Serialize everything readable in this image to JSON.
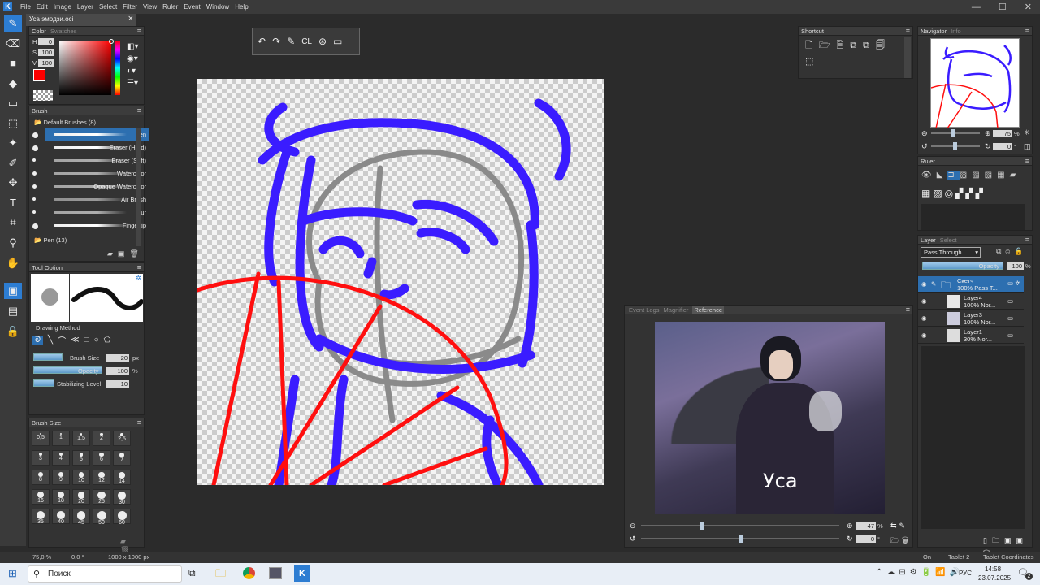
{
  "app": {
    "logo": "K",
    "menus": [
      "File",
      "Edit",
      "Image",
      "Layer",
      "Select",
      "Filter",
      "View",
      "Ruler",
      "Event",
      "Window",
      "Help"
    ],
    "doc_tab": "Уса эмодзи.oci",
    "win_min": "—",
    "win_max": "☐",
    "win_close": "✕"
  },
  "color_panel": {
    "tabs": [
      "Color",
      "Swatches"
    ],
    "h_label": "H",
    "s_label": "S",
    "v_label": "V",
    "h": "0",
    "s": "100",
    "v": "100",
    "primary": "#ff0000"
  },
  "brush_panel": {
    "title": "Brush",
    "group": "Default Brushes (8)",
    "items": [
      "Pen",
      "Eraser (Hard)",
      "Eraser (Soft)",
      "Watercolor",
      "Opaque Watercolor",
      "Air Brush",
      "Blur",
      "Fingertip"
    ],
    "group2": "Pen (13)"
  },
  "tool_option": {
    "title": "Tool Option",
    "drawing_method": "Drawing Method",
    "brush_size_label": "Brush Size",
    "brush_size": "20",
    "brush_size_unit": "px",
    "opacity_label": "Opacity",
    "opacity": "100",
    "opacity_unit": "%",
    "stab_label": "Stabilizing Level",
    "stab": "10"
  },
  "brush_size_panel": {
    "title": "Brush Size",
    "sizes": [
      "0,5",
      "1",
      "1,5",
      "2",
      "2,5",
      "3",
      "4",
      "5",
      "6",
      "7",
      "8",
      "9",
      "10",
      "12",
      "14",
      "16",
      "18",
      "20",
      "25",
      "30",
      "35",
      "40",
      "45",
      "50",
      "60"
    ]
  },
  "shortcut": {
    "title": "Shortcut"
  },
  "navigator": {
    "tabs": [
      "Navigator",
      "Info"
    ],
    "zoom": "75",
    "zoom_unit": "%",
    "rotation": "0",
    "rotation_unit": "°"
  },
  "ruler": {
    "title": "Ruler"
  },
  "layer": {
    "tabs": [
      "Layer",
      "Select"
    ],
    "blend": "Pass Through",
    "opacity_label": "Opacity",
    "opacity": "100",
    "opacity_unit": "%",
    "items": [
      {
        "name": "Скетч",
        "mode": "100% Pass T..."
      },
      {
        "name": "Layer4",
        "mode": "100% Nor..."
      },
      {
        "name": "Layer3",
        "mode": "100% Nor..."
      },
      {
        "name": "Layer1",
        "mode": "30% Nor..."
      }
    ]
  },
  "reference": {
    "tabs": [
      "Event Logs",
      "Magnifier",
      "Reference"
    ],
    "caption": "Уса",
    "zoom": "47",
    "zoom_unit": "%",
    "rotation": "0",
    "rotation_unit": "°"
  },
  "status": {
    "zoom": "75,0 %",
    "angle": "0,0 °",
    "size": "1000 x 1000 px",
    "on": "On",
    "tablet": "Tablet 2",
    "coords": "Tablet Coordinates"
  },
  "taskbar": {
    "search": "Поиск",
    "lang": "РУС",
    "time": "14:58",
    "date": "23.07.2025",
    "notif": "2"
  },
  "colors": {
    "accent": "#2d7dd2",
    "sketch_blue": "#3a1cff",
    "sketch_red": "#ff0f0f"
  }
}
